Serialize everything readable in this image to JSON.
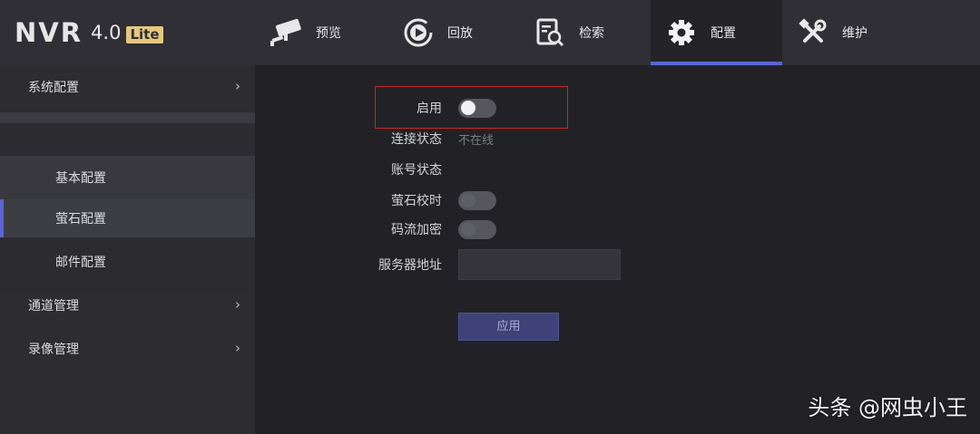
{
  "logo": {
    "main": "NVR",
    "version": "4.0",
    "badge": "Lite"
  },
  "nav": [
    {
      "label": "预览",
      "icon": "camera-icon"
    },
    {
      "label": "回放",
      "icon": "playback-icon"
    },
    {
      "label": "检索",
      "icon": "search-doc-icon"
    },
    {
      "label": "配置",
      "icon": "gear-icon",
      "active": true
    },
    {
      "label": "维护",
      "icon": "tools-icon"
    }
  ],
  "sidebar": {
    "items": [
      {
        "label": "系统配置"
      },
      {
        "label": "基本配置"
      },
      {
        "label": "萤石配置",
        "selected": true
      },
      {
        "label": "邮件配置"
      },
      {
        "label": "通道管理"
      },
      {
        "label": "录像管理"
      }
    ]
  },
  "form": {
    "enable_label": "启用",
    "conn_status_label": "连接状态",
    "conn_status_value": "不在线",
    "account_status_label": "账号状态",
    "time_sync_label": "萤石校时",
    "stream_encrypt_label": "码流加密",
    "server_addr_label": "服务器地址",
    "server_addr_value": "",
    "apply_label": "应用",
    "enable_on": false,
    "time_sync_on": false,
    "stream_encrypt_on": false
  },
  "colors": {
    "accent": "#5b66d6",
    "highlight_border": "#c42a2a"
  },
  "watermark": "头条 @网虫小王"
}
